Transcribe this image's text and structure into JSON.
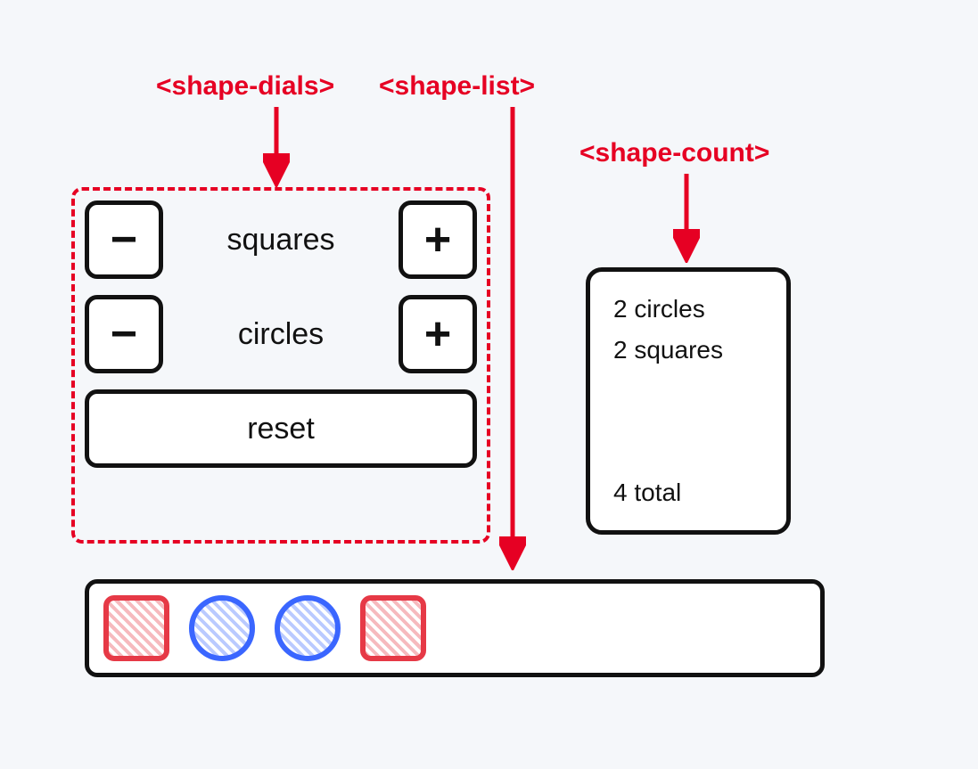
{
  "annotations": {
    "shape_dials": "<shape-dials>",
    "shape_list": "<shape-list>",
    "shape_count": "<shape-count>"
  },
  "dials": {
    "rows": [
      {
        "label": "squares",
        "minus": "−",
        "plus": "+"
      },
      {
        "label": "circles",
        "minus": "−",
        "plus": "+"
      }
    ],
    "reset_label": "reset"
  },
  "count": {
    "lines": [
      "2 circles",
      "2 squares"
    ],
    "total": "4 total"
  },
  "shapes": [
    {
      "kind": "square"
    },
    {
      "kind": "circle"
    },
    {
      "kind": "circle"
    },
    {
      "kind": "square"
    }
  ],
  "colors": {
    "annotation_red": "#e60023",
    "square_red": "#e63946",
    "circle_blue": "#3a66ff",
    "stroke": "#111111",
    "bg": "#f5f7fa"
  }
}
